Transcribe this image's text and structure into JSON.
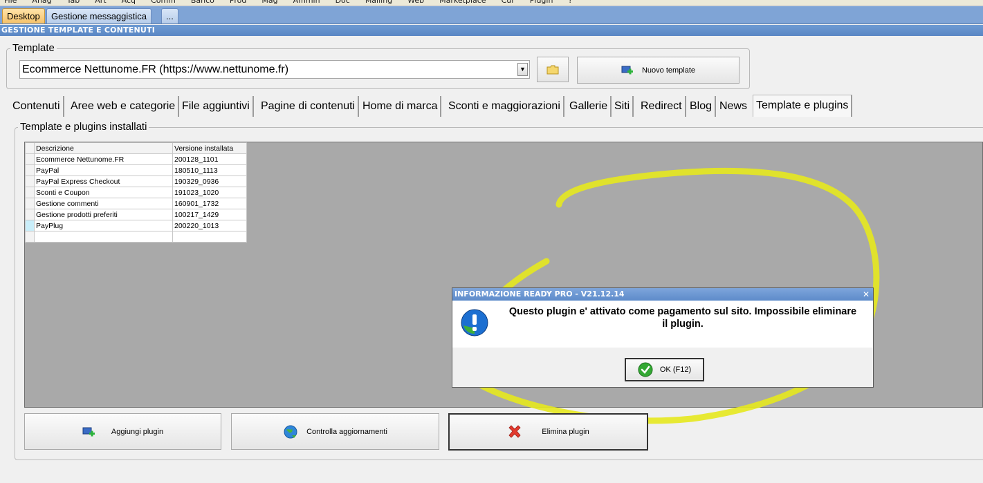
{
  "menubar": {
    "items": [
      "File",
      "Anag",
      "Tab",
      "Art",
      "Acq",
      "Comm",
      "Banco",
      "Prod",
      "Mag",
      "Ammin",
      "Doc",
      "Mailing",
      "Web",
      "Marketplace",
      "Cur",
      "Plugin",
      "?"
    ]
  },
  "window_tabs": [
    {
      "label": "Desktop",
      "active": true
    },
    {
      "label": "Gestione messaggistica",
      "active": false
    },
    {
      "label": "...",
      "active": false
    }
  ],
  "section": {
    "title": "GESTIONE TEMPLATE E CONTENUTI"
  },
  "template": {
    "group_label": "Template",
    "selected": "Ecommerce Nettunome.FR (https://www.nettunome.fr)",
    "new_button": "Nuovo template"
  },
  "tabs": [
    "Contenuti",
    "Aree web e categorie",
    "File aggiuntivi",
    "Pagine di contenuti",
    "Home di marca",
    "Sconti e maggiorazioni",
    "Gallerie",
    "Siti",
    "Redirect",
    "Blog",
    "News",
    "Template e plugins"
  ],
  "active_tab": "Template e plugins",
  "plugins": {
    "group_label": "Template e plugins installati",
    "columns": [
      "Descrizione",
      "Versione installata"
    ],
    "rows": [
      [
        "Ecommerce Nettunome.FR",
        "200128_1101"
      ],
      [
        "PayPal",
        "180510_1113"
      ],
      [
        "PayPal Express Checkout",
        "190329_0936"
      ],
      [
        "Sconti e Coupon",
        "191023_1020"
      ],
      [
        "Gestione commenti",
        "160901_1732"
      ],
      [
        "Gestione prodotti preferiti",
        "100217_1429"
      ],
      [
        "PayPlug",
        "200220_1013"
      ]
    ]
  },
  "dialog": {
    "title": "INFORMAZIONE READY PRO - V21.12.14",
    "message": "Questo plugin e' attivato come pagamento sul sito. Impossibile eliminare il plugin.",
    "ok_label": "OK (F12)"
  },
  "buttons": {
    "add": "Aggiungi plugin",
    "check": "Controlla aggiornamenti",
    "delete": "Elimina plugin"
  },
  "colors": {
    "highlight": "#e8ea1a",
    "titlebar": "#5d8bca",
    "active_tab": "#f6c26a"
  }
}
